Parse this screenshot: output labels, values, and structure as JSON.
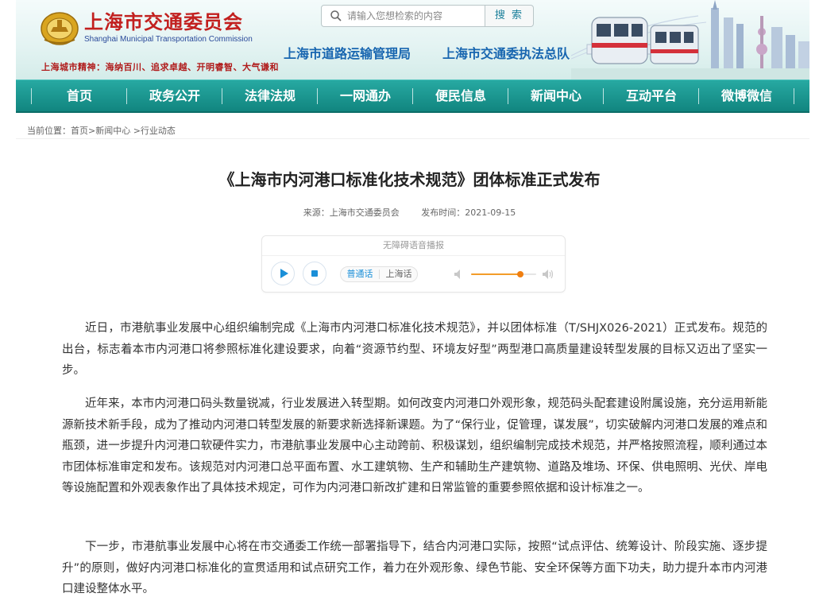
{
  "header": {
    "site_title": "上海市交通委员会",
    "site_subtitle": "Shanghai Municipal Transportation Commission",
    "spirit": "上海城市精神：海纳百川、追求卓越、开明睿智、大气谦和",
    "search": {
      "placeholder": "请输入您想检索的内容",
      "button_label": "搜 索"
    },
    "links": [
      "上海市道路运输管理局",
      "上海市交通委执法总队"
    ]
  },
  "nav": {
    "items": [
      "首页",
      "政务公开",
      "法律法规",
      "一网通办",
      "便民信息",
      "新闻中心",
      "互动平台",
      "微博微信"
    ]
  },
  "breadcrumb": "当前位置：首页>新闻中心 >行业动态",
  "article": {
    "title": "《上海市内河港口标准化技术规范》团体标准正式发布",
    "source": "来源：上海市交通委员会",
    "date": "发布时间：2021-09-15",
    "paragraphs": [
      "近日，市港航事业发展中心组织编制完成《上海市内河港口标准化技术规范》，并以团体标准（T/SHJX026-2021）正式发布。规范的出台，标志着本市内河港口将参照标准化建设要求，向着“资源节约型、环境友好型”两型港口高质量建设转型发展的目标又迈出了坚实一步。",
      "近年来，本市内河港口码头数量锐减，行业发展进入转型期。如何改变内河港口外观形象，规范码头配套建设附属设施，充分运用新能源新技术新手段，成为了推动内河港口转型发展的新要求新选择新课题。为了“保行业，促管理，谋发展”，切实破解内河港口发展的难点和瓶颈，进一步提升内河港口软硬件实力，市港航事业发展中心主动跨前、积极谋划，组织编制完成技术规范，并严格按照流程，顺利通过本市团体标准审定和发布。该规范对内河港口总平面布置、水工建筑物、生产和辅助生产建筑物、道路及堆场、环保、供电照明、光伏、岸电等设施配置和外观表象作出了具体技术规定，可作为内河港口新改扩建和日常监管的重要参照依据和设计标准之一。",
      "下一步，市港航事业发展中心将在市交通委工作统一部署指导下，结合内河港口实际，按照“试点评估、统筹设计、阶段实施、逐步提升”的原则，做好内河港口标准化的宣贯适用和试点研究工作，着力在外观形象、绿色节能、安全环保等方面下功夫，助力提升本市内河港口建设整体水平。"
    ]
  },
  "player": {
    "title": "无障碍语音播报",
    "lang_options": [
      "普通话",
      "上海话"
    ],
    "active_lang": "普通话",
    "volume": 0.75
  },
  "colors": {
    "nav": "#1a9690",
    "title_red": "#c2201f",
    "link_blue": "#1866b0",
    "accent_orange": "#f07f10"
  }
}
